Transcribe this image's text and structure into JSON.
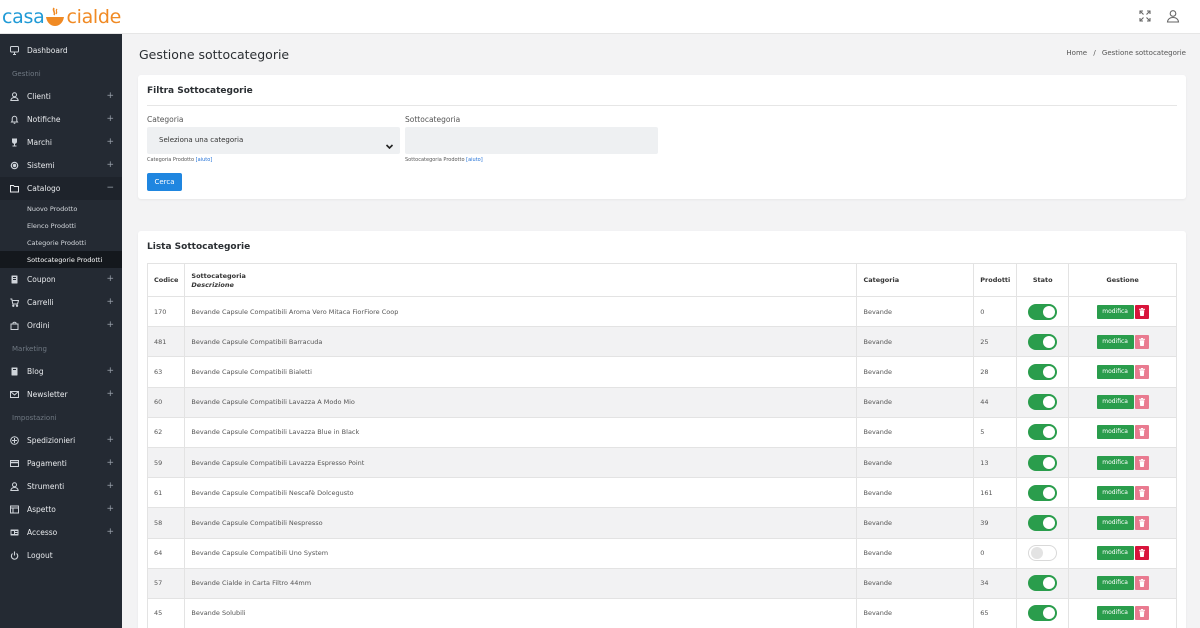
{
  "app": {
    "logo_left": "casa",
    "logo_right": "cialde"
  },
  "colors": {
    "sidebar_bg": "#242a33",
    "primary": "#1f86e0",
    "success": "#2a9d4c",
    "danger": "#d8143b",
    "danger_light": "#e97b90"
  },
  "sidebar": {
    "items": [
      {
        "label": "Dashboard",
        "icon": "monitor-icon",
        "expandable": false
      },
      {
        "section": "Gestioni"
      },
      {
        "label": "Clienti",
        "icon": "user-icon",
        "expandable": true
      },
      {
        "label": "Notifiche",
        "icon": "bell-icon",
        "expandable": true
      },
      {
        "label": "Marchi",
        "icon": "trophy-icon",
        "expandable": true
      },
      {
        "label": "Sistemi",
        "icon": "gear-icon",
        "expandable": true
      },
      {
        "label": "Catalogo",
        "icon": "folder-icon",
        "expandable": true,
        "open": true
      },
      {
        "label": "Coupon",
        "icon": "ticket-icon",
        "expandable": true
      },
      {
        "label": "Carrelli",
        "icon": "cart-icon",
        "expandable": true
      },
      {
        "label": "Ordini",
        "icon": "bag-icon",
        "expandable": true
      },
      {
        "section": "Marketing"
      },
      {
        "label": "Blog",
        "icon": "book-icon",
        "expandable": true
      },
      {
        "label": "Newsletter",
        "icon": "mail-icon",
        "expandable": true
      },
      {
        "section": "Impostazioni"
      },
      {
        "label": "Spedizionieri",
        "icon": "truck-icon",
        "expandable": true
      },
      {
        "label": "Pagamenti",
        "icon": "card-icon",
        "expandable": true
      },
      {
        "label": "Strumenti",
        "icon": "wrench-icon",
        "expandable": true
      },
      {
        "label": "Aspetto",
        "icon": "layout-icon",
        "expandable": true
      },
      {
        "label": "Accesso",
        "icon": "id-icon",
        "expandable": true
      },
      {
        "label": "Logout",
        "icon": "power-icon",
        "expandable": false
      }
    ],
    "catalog_sub": [
      {
        "label": "Nuovo Prodotto",
        "active": false
      },
      {
        "label": "Elenco Prodotti",
        "active": false
      },
      {
        "label": "Categorie Prodotti",
        "active": false
      },
      {
        "label": "Sottocategorie Prodotti",
        "active": true
      }
    ]
  },
  "header": {
    "title": "Gestione sottocategorie",
    "breadcrumb_home": "Home",
    "breadcrumb_sep": "/",
    "breadcrumb_current": "Gestione sottocategorie"
  },
  "filter": {
    "title": "Filtra Sottocategorie",
    "category_label": "Categoria",
    "category_value": "Seleziona una categoria",
    "category_help": "Categoria Prodotto",
    "category_help_link": "[aiuto]",
    "subcategory_label": "Sottocategoria",
    "subcategory_value": "",
    "subcategory_help": "Sottocategoria Prodotto",
    "subcategory_help_link": "[aiuto]",
    "search_button": "Cerca"
  },
  "list": {
    "title": "Lista Sottocategorie",
    "columns": {
      "code": "Codice",
      "subcategory": "Sottocategoria",
      "description": "Descrizione",
      "category": "Categoria",
      "products": "Prodotti",
      "state": "Stato",
      "actions": "Gestione"
    },
    "edit_label": "modifica",
    "rows": [
      {
        "code": "170",
        "name": "Bevande Capsule Compatibili Aroma Vero Mitaca FiorFiore Coop",
        "category": "Bevande",
        "products": "0",
        "active": true,
        "delete_enabled": true
      },
      {
        "code": "481",
        "name": "Bevande Capsule Compatibili Barracuda",
        "category": "Bevande",
        "products": "25",
        "active": true,
        "delete_enabled": false
      },
      {
        "code": "63",
        "name": "Bevande Capsule Compatibili Bialetti",
        "category": "Bevande",
        "products": "28",
        "active": true,
        "delete_enabled": false
      },
      {
        "code": "60",
        "name": "Bevande Capsule Compatibili Lavazza A Modo Mio",
        "category": "Bevande",
        "products": "44",
        "active": true,
        "delete_enabled": false
      },
      {
        "code": "62",
        "name": "Bevande Capsule Compatibili Lavazza Blue in Black",
        "category": "Bevande",
        "products": "5",
        "active": true,
        "delete_enabled": false
      },
      {
        "code": "59",
        "name": "Bevande Capsule Compatibili Lavazza Espresso Point",
        "category": "Bevande",
        "products": "13",
        "active": true,
        "delete_enabled": false
      },
      {
        "code": "61",
        "name": "Bevande Capsule Compatibili Nescafè Dolcegusto",
        "category": "Bevande",
        "products": "161",
        "active": true,
        "delete_enabled": false
      },
      {
        "code": "58",
        "name": "Bevande Capsule Compatibili Nespresso",
        "category": "Bevande",
        "products": "39",
        "active": true,
        "delete_enabled": false
      },
      {
        "code": "64",
        "name": "Bevande Capsule Compatibili Uno System",
        "category": "Bevande",
        "products": "0",
        "active": false,
        "delete_enabled": true
      },
      {
        "code": "57",
        "name": "Bevande Cialde in Carta Filtro 44mm",
        "category": "Bevande",
        "products": "34",
        "active": true,
        "delete_enabled": false
      },
      {
        "code": "45",
        "name": "Bevande Solubili",
        "category": "Bevande",
        "products": "65",
        "active": true,
        "delete_enabled": false
      }
    ]
  }
}
